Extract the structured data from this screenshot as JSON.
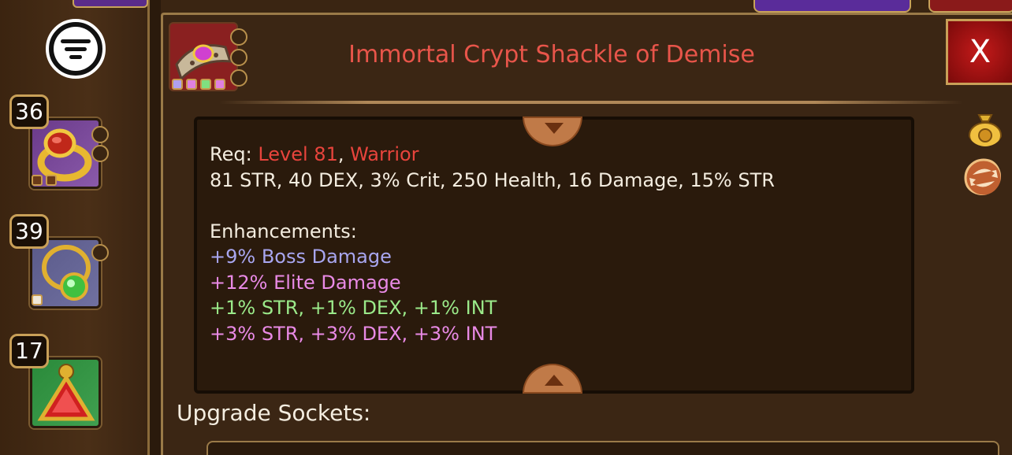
{
  "sidebar": {
    "filter_icon": "filter-icon",
    "items": [
      {
        "level": "36",
        "icon": "ring-icon",
        "sockets": 2,
        "mini_slots": 2
      },
      {
        "level": "39",
        "icon": "amulet-icon",
        "sockets": 1,
        "mini_slots": 1
      },
      {
        "level": "17",
        "icon": "talisman-icon",
        "sockets": 0,
        "mini_slots": 0
      }
    ]
  },
  "item": {
    "title": "Immortal Crypt Shackle of Demise",
    "icon": "shackle-icon",
    "close_label": "X",
    "req_label": "Req: ",
    "req_level": "Level 81",
    "req_sep": ", ",
    "req_class": "Warrior",
    "stats": "81 STR, 40 DEX, 3% Crit, 250 Health, 16 Damage, 15% STR",
    "enh_label": "Enhancements:",
    "enhancements": [
      {
        "text": "+9% Boss Damage",
        "color": "#a8a6f0"
      },
      {
        "text": "+12% Elite Damage",
        "color": "#e98ae6"
      },
      {
        "text": "+1% STR, +1% DEX, +1% INT",
        "color": "#9bea8a"
      },
      {
        "text": "+3% STR, +3% DEX, +3% INT",
        "color": "#e98ae6"
      }
    ]
  },
  "upgrade_sockets_label": "Upgrade Sockets:",
  "side_icons": [
    "gold-bag-icon",
    "swap-icon"
  ]
}
